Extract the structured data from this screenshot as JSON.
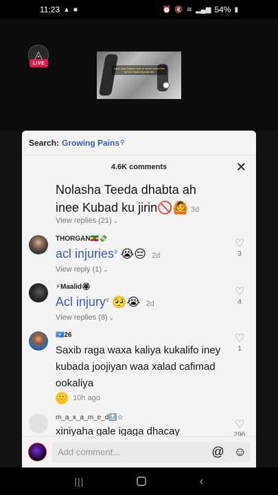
{
  "status_bar": {
    "time": "11:23",
    "battery": "54%"
  },
  "video": {
    "live_label": "LIVE",
    "thumbnail_caption": "Lake Wao Takaltd sale bl achar-mhad Der lai Iubi Dada ell phile allo"
  },
  "search": {
    "prefix": "Search:",
    "term": "Growing Pains"
  },
  "comments_header": {
    "count_label": "4.6K comments"
  },
  "comments": [
    {
      "text": "Nolasha Teeda dhabta ah inee Kubad ku jirin🚫🙆",
      "time": "3d",
      "replies": "View replies (21)"
    },
    {
      "username": "THORGAN🇪🇹💸",
      "link_text": "acl injuries",
      "emoji": "😭😔",
      "time": "2d",
      "replies": "View reply (1)",
      "likes": "3"
    },
    {
      "username": "⚡Maalid🏵",
      "link_text": "Acl injury",
      "emoji": "🥺😭",
      "time": "2d",
      "replies": "View replies (8)",
      "likes": "4"
    },
    {
      "username": "🇸🇴26",
      "text": "Saxib raga waxa kaliya kukalifo iney kubada joojiyan waa xalad cafimad ookaliya",
      "emoji": "🙂",
      "time": "10h ago",
      "likes": "1"
    },
    {
      "username": "m_a_x_a_m_e_d🔝☆",
      "text": "xiniyaha gale igaga dhacay",
      "likes": "296"
    }
  ],
  "add_comment": {
    "placeholder": "Add comment..."
  },
  "colors": {
    "link": "#3b5ea8",
    "live": "#e5184b",
    "sheet_bg": "#f3f3f4"
  }
}
